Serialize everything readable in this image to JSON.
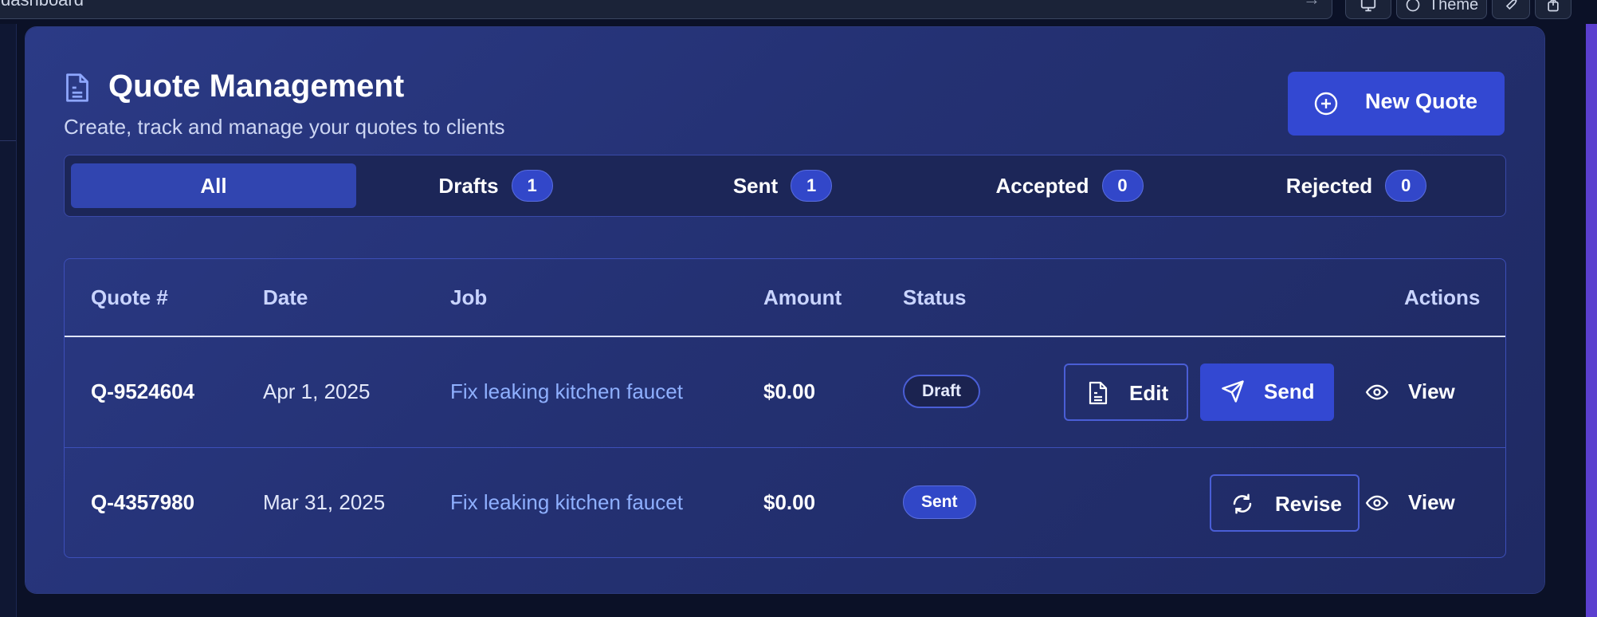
{
  "browser": {
    "url": "dashboard",
    "theme_label": "Theme"
  },
  "header": {
    "title": "Quote Management",
    "subtitle": "Create, track and manage your quotes to clients",
    "new_quote_label": "New Quote"
  },
  "tabs": [
    {
      "label": "All",
      "count": null,
      "active": true
    },
    {
      "label": "Drafts",
      "count": "1",
      "active": false
    },
    {
      "label": "Sent",
      "count": "1",
      "active": false
    },
    {
      "label": "Accepted",
      "count": "0",
      "active": false
    },
    {
      "label": "Rejected",
      "count": "0",
      "active": false
    }
  ],
  "table": {
    "columns": [
      "Quote #",
      "Date",
      "Job",
      "Amount",
      "Status",
      "Actions"
    ],
    "rows": [
      {
        "quote_no": "Q-9524604",
        "date": "Apr 1, 2025",
        "job": "Fix leaking kitchen faucet",
        "amount": "$0.00",
        "status": "Draft",
        "actions": {
          "edit": "Edit",
          "send": "Send",
          "view": "View"
        }
      },
      {
        "quote_no": "Q-4357980",
        "date": "Mar 31, 2025",
        "job": "Fix leaking kitchen faucet",
        "amount": "$0.00",
        "status": "Sent",
        "actions": {
          "revise": "Revise",
          "view": "View"
        }
      }
    ]
  },
  "colors": {
    "accent": "#3348d2",
    "card_bg": "#26357a",
    "link": "#8fb0ff"
  }
}
